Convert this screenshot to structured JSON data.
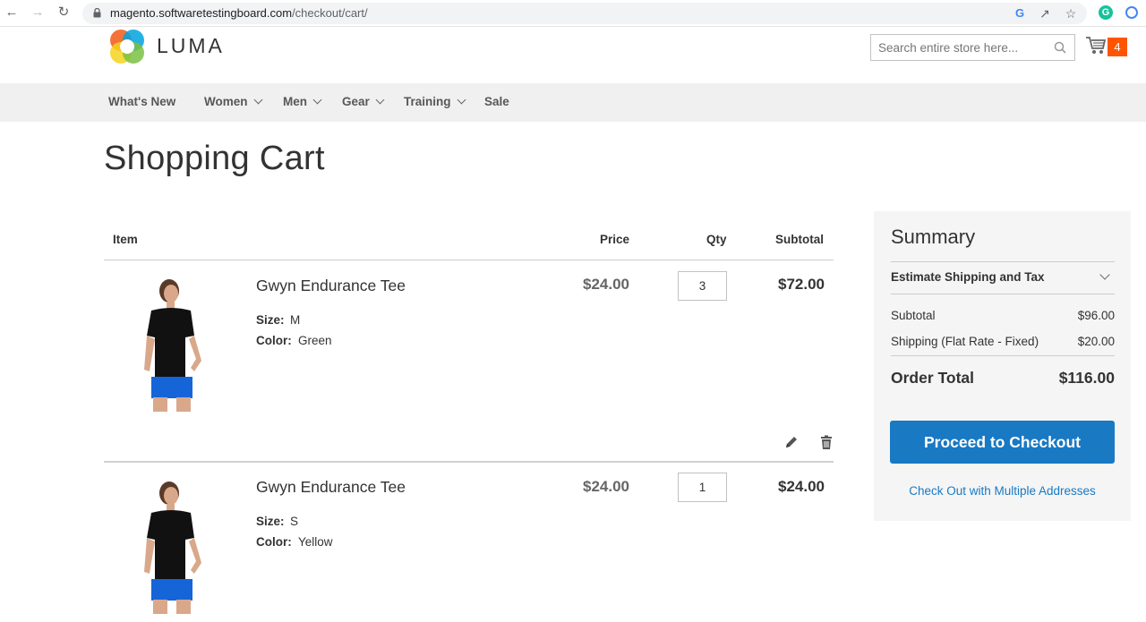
{
  "browser": {
    "url_host": "magento.softwaretestingboard.com",
    "url_path": "/checkout/cart/"
  },
  "header": {
    "logo_text": "LUMA",
    "search_placeholder": "Search entire store here...",
    "cart_count": "4"
  },
  "nav": {
    "items": [
      {
        "label": "What's New",
        "has_dropdown": false
      },
      {
        "label": "Women",
        "has_dropdown": true
      },
      {
        "label": "Men",
        "has_dropdown": true
      },
      {
        "label": "Gear",
        "has_dropdown": true
      },
      {
        "label": "Training",
        "has_dropdown": true
      },
      {
        "label": "Sale",
        "has_dropdown": false
      }
    ]
  },
  "page": {
    "title": "Shopping Cart"
  },
  "cart_table": {
    "headers": {
      "item": "Item",
      "price": "Price",
      "qty": "Qty",
      "subtotal": "Subtotal"
    },
    "rows": [
      {
        "name": "Gwyn Endurance Tee",
        "size_label": "Size:",
        "size_value": "M",
        "color_label": "Color:",
        "color_value": "Green",
        "price": "$24.00",
        "qty": "3",
        "subtotal": "$72.00"
      },
      {
        "name": "Gwyn Endurance Tee",
        "size_label": "Size:",
        "size_value": "S",
        "color_label": "Color:",
        "color_value": "Yellow",
        "price": "$24.00",
        "qty": "1",
        "subtotal": "$24.00"
      }
    ]
  },
  "summary": {
    "title": "Summary",
    "estimate_label": "Estimate Shipping and Tax",
    "subtotal_label": "Subtotal",
    "subtotal_value": "$96.00",
    "shipping_label": "Shipping (Flat Rate - Fixed)",
    "shipping_value": "$20.00",
    "order_total_label": "Order Total",
    "order_total_value": "$116.00",
    "checkout_button": "Proceed to Checkout",
    "multi_address_link": "Check Out with Multiple Addresses"
  },
  "colors": {
    "accent_blue": "#1979c3",
    "cart_badge": "#ff5501",
    "nav_bg": "#f0f0f0",
    "summary_bg": "#f5f5f5"
  }
}
